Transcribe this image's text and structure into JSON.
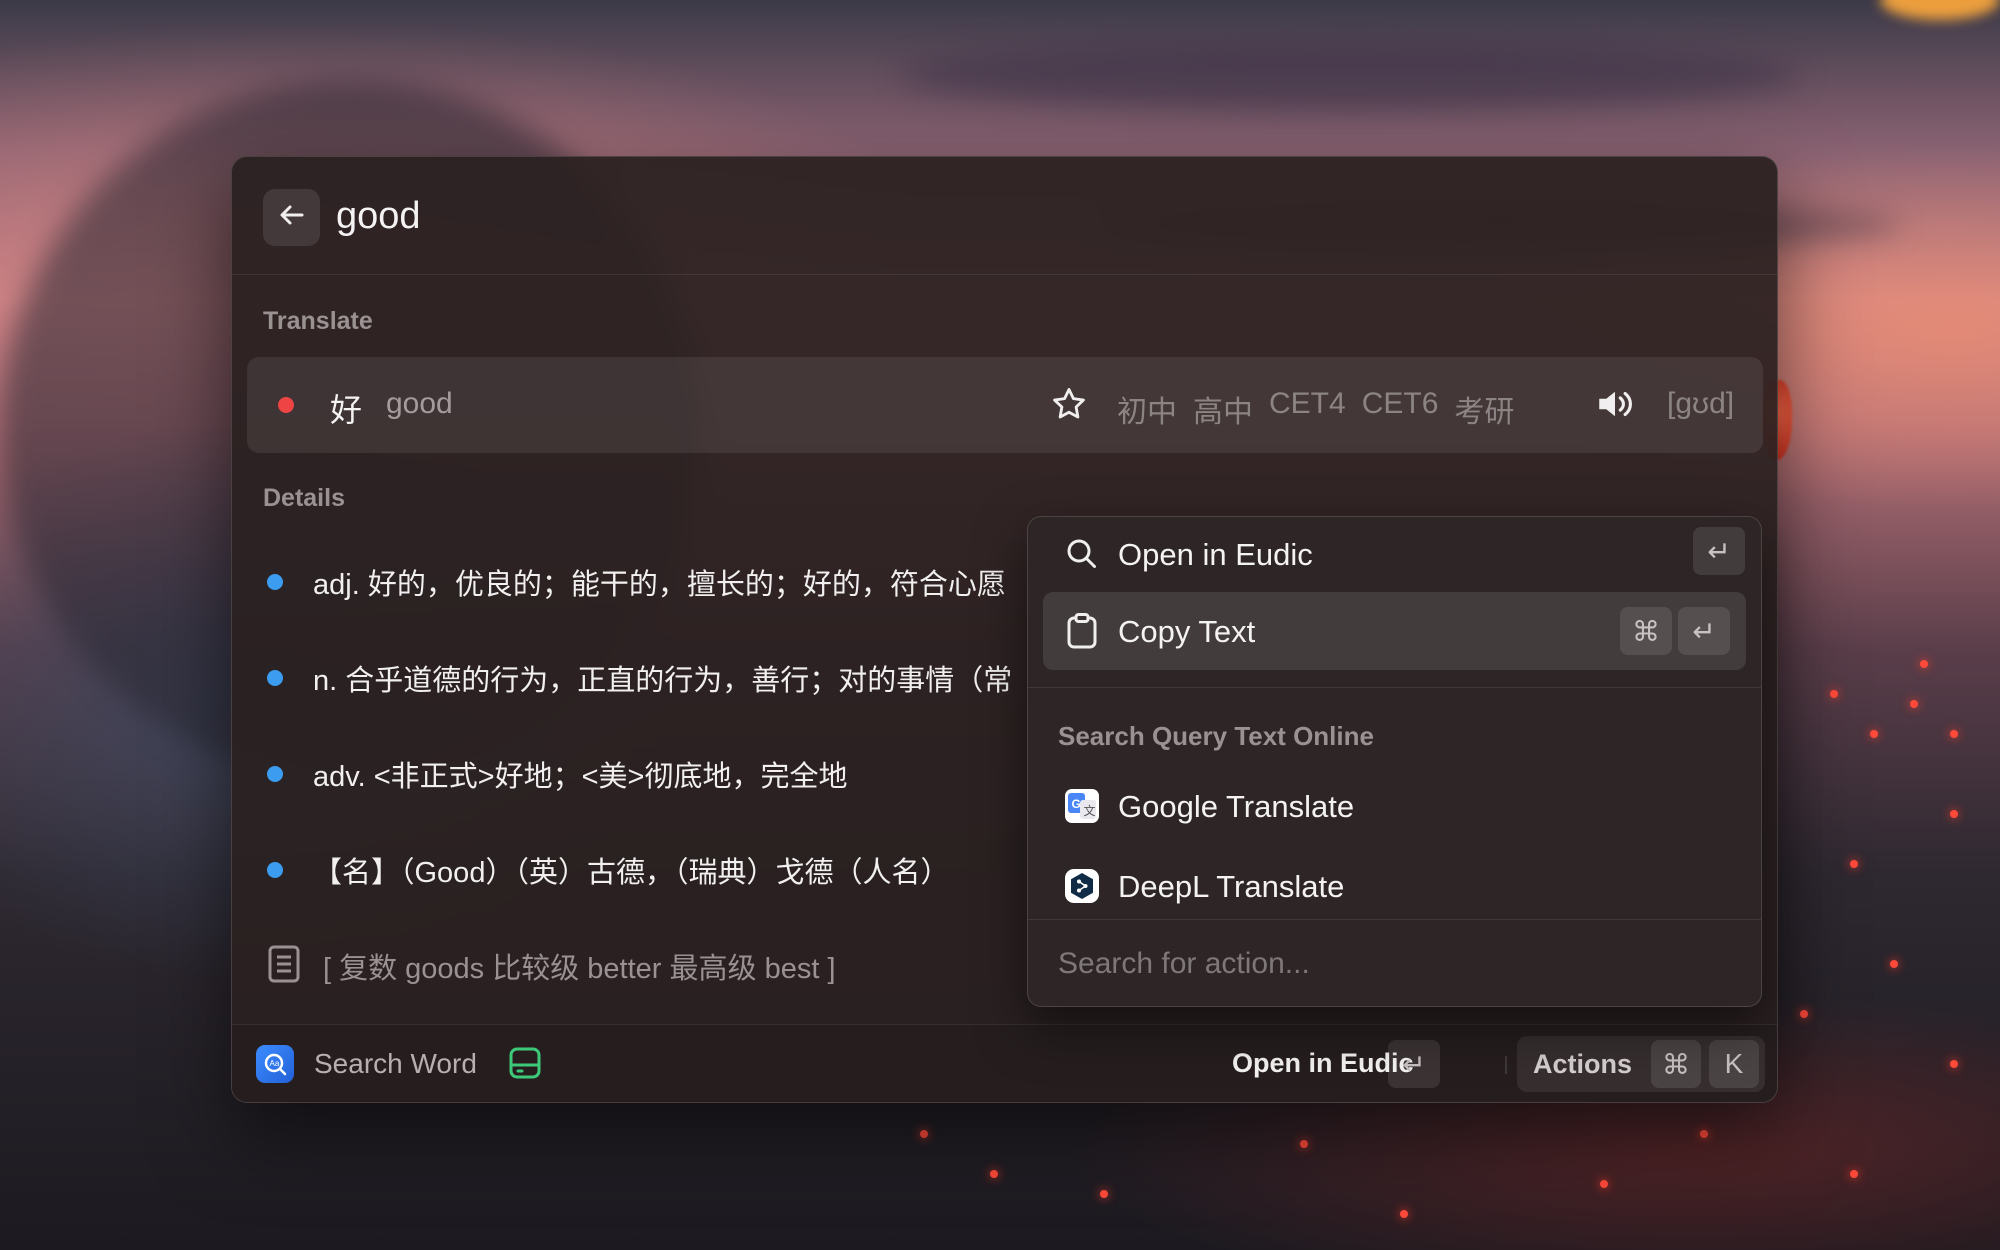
{
  "window": {
    "query": "good"
  },
  "translate": {
    "section_title": "Translate",
    "chinese": "好",
    "english": "good",
    "tags": [
      "初中",
      "高中",
      "CET4",
      "CET6",
      "考研"
    ],
    "phonetic": "[ɡʊd]",
    "status_color": "#ef4444"
  },
  "details": {
    "section_title": "Details",
    "items": [
      "adj. 好的，优良的；能干的，擅长的；好的，符合心愿",
      "n. 合乎道德的行为，正直的行为，善行；对的事情（常",
      "adv. <非正式>好地；<美>彻底地，完全地",
      "【名】（Good）（英）古德，（瑞典）戈德（人名）"
    ],
    "word_forms": "[ 复数 goods   比较级 better   最高级 best ]"
  },
  "footer": {
    "app_title": "Search Word",
    "primary_action": "Open in Eudic",
    "actions_label": "Actions",
    "keys": {
      "enter": "↵",
      "cmd": "⌘",
      "k": "K"
    }
  },
  "popup": {
    "items": [
      {
        "label": "Open in Eudic",
        "icon": "search-icon",
        "shortcut": [
          "↵"
        ]
      },
      {
        "label": "Copy Text",
        "icon": "clipboard-icon",
        "shortcut": [
          "⌘",
          "↵"
        ]
      }
    ],
    "section_title": "Search Query Text Online",
    "online_items": [
      {
        "label": "Google Translate",
        "icon": "google-translate-icon"
      },
      {
        "label": "DeepL Translate",
        "icon": "deepl-icon"
      }
    ],
    "search_placeholder": "Search for action..."
  }
}
